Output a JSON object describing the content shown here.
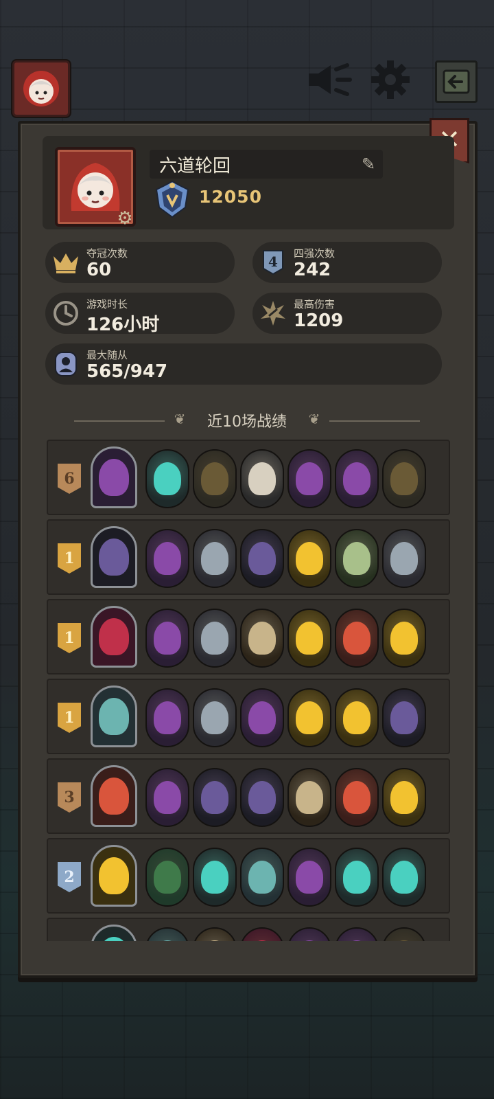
{
  "profile": {
    "name": "六道轮回",
    "rank_score": "12050"
  },
  "stats": {
    "championships": {
      "label": "夺冠次数",
      "value": "60"
    },
    "top4": {
      "label": "四强次数",
      "value": "242",
      "icon_text": "4"
    },
    "play_time": {
      "label": "游戏时长",
      "value": "126小时"
    },
    "max_damage": {
      "label": "最高伤害",
      "value": "1209"
    },
    "max_minions": {
      "label": "最大随从",
      "value": "565/947"
    }
  },
  "section": {
    "title": "近10场战绩"
  },
  "colors": {
    "gold_badge": "#d9a441",
    "brown_badge": "#b8895a",
    "silver_badge": "#8ea9c8",
    "panel": "#3b3833"
  },
  "matches": [
    {
      "place": "6",
      "hero_icon": "purple-dragon-hero-icon",
      "minions": [
        "blue-plant-minion-icon",
        "white-bird-minion-icon",
        "teal-wolf-minion-icon",
        "scarecrow-minion-icon",
        "radish-ghost-minion-icon",
        "red-demon-minion-icon"
      ]
    },
    {
      "place": "1",
      "hero_icon": "hooded-goblin-hero-icon",
      "minions": [
        "purple-dragon-minion-icon",
        "bone-dragon-minion-icon",
        "golden-demon-minion-icon",
        "plague-doctor-minion-icon",
        "gargoyle-minion-icon",
        "teal-ghost-minion-icon"
      ]
    },
    {
      "place": "1",
      "hero_icon": "skull-totem-hero-icon",
      "minions": [
        "purple-dragon-minion-icon",
        "shadow-girl-minion-icon",
        "gargoyle-minion-icon",
        "plague-doctor-minion-icon",
        "teal-ghost-minion-icon",
        "jester-minion-icon"
      ]
    },
    {
      "place": "1",
      "hero_icon": "blue-fairy-hero-icon",
      "minions": [
        "purple-dragon-minion-icon",
        "shadow-girl-minion-icon",
        "jester-minion-icon",
        "plague-doctor-minion-icon",
        "golden-priestess-minion-icon",
        "gargoyle-minion-icon"
      ]
    },
    {
      "place": "3",
      "hero_icon": "dark-witch-hero-icon",
      "minions": [
        "purple-dragon-minion-icon",
        "robot-box-minion-icon",
        "masked-thief-minion-icon",
        "blue-rabbit-minion-icon",
        "red-knight-minion-icon",
        "jester-minion-icon"
      ]
    },
    {
      "place": "2",
      "hero_icon": "old-wizard-hero-icon",
      "minions": [
        "golden-warrior-minion-icon",
        "armored-beast-minion-icon",
        "dark-knight-minion-icon",
        "red-demon-minion-icon",
        "bone-lord-minion-icon",
        "pumpkin-head-minion-icon"
      ]
    },
    {
      "place": "",
      "hero_icon": "dark-lord-hero-icon",
      "minions": [
        "spike-minion-icon",
        "frost-minion-icon",
        "frost-minion-icon",
        "scarecrow-minion-icon",
        "horned-beast-minion-icon",
        "blue-mage-minion-icon"
      ]
    }
  ]
}
